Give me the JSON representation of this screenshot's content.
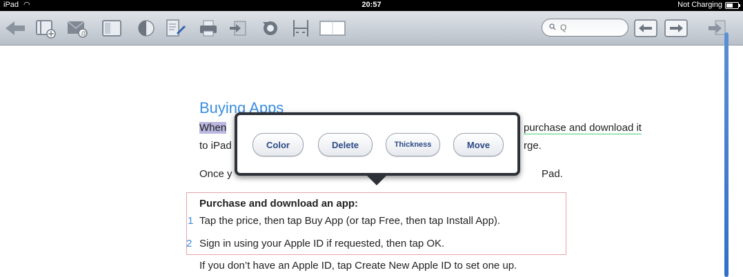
{
  "status": {
    "carrier": "iPad",
    "time": "20:57",
    "charge_status": "Not Charging"
  },
  "toolbar": {
    "icons": [
      "back-arrow-icon",
      "add-bookmark-icon",
      "email-icon",
      "book-icon",
      "contrast-icon",
      "annotate-icon",
      "print-icon",
      "export-icon",
      "rotate-icon",
      "split-view-icon",
      "single-page-icon"
    ],
    "search_placeholder": "Q",
    "nav_icons": [
      "previous-page-icon",
      "next-page-icon",
      "forward-icon"
    ]
  },
  "document": {
    "title": "Buying Apps",
    "para1_start": "When",
    "para1_end": "purchase and download it",
    "para2_start": "to iPad",
    "para2_end": "rge.",
    "para3_start": "Once y",
    "para3_end": "Pad.",
    "box_heading": "Purchase and download an app:",
    "steps": [
      {
        "num": "1",
        "text": "Tap the price, then tap Buy App (or tap Free, then tap Install App)."
      },
      {
        "num": "2",
        "text": "Sign in using your Apple ID if requested, then tap OK."
      }
    ],
    "footer_text": "If you don’t have an Apple ID, tap Create New Apple ID to set one up."
  },
  "popover": {
    "buttons": [
      "Color",
      "Delete",
      "Thickness",
      "Move"
    ]
  },
  "colors": {
    "accent": "#3a8ee0",
    "highlight": "#b9b6df",
    "box_border": "#e7a3a8"
  }
}
